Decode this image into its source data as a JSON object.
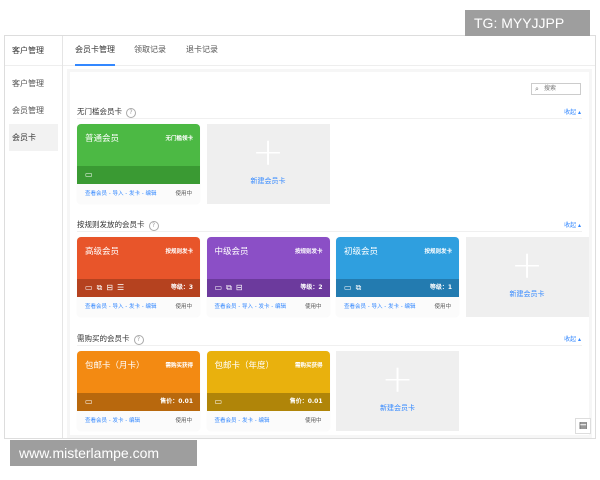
{
  "sidebar": {
    "header": "客户管理",
    "items": [
      {
        "label": "客户管理"
      },
      {
        "label": "会员管理"
      },
      {
        "label": "会员卡",
        "active": true
      }
    ]
  },
  "tabs": [
    {
      "label": "会员卡管理",
      "active": true
    },
    {
      "label": "领取记录"
    },
    {
      "label": "退卡记录"
    }
  ],
  "search": {
    "placeholder": "搜索",
    "icon": "search-icon"
  },
  "collapse_label": "收起 ▴",
  "new_card_label": "新建会员卡",
  "sections": [
    {
      "title": "无门槛会员卡",
      "cards": [
        {
          "name": "普通会员",
          "type": "无门槛领卡",
          "color": "#4cb944",
          "strip": "#3a9a33",
          "icons": 1,
          "right": "",
          "links": "查看会员 - 导入 - 发卡 - 编辑",
          "status": "使用中"
        }
      ]
    },
    {
      "title": "按规则发放的会员卡",
      "cards": [
        {
          "name": "高级会员",
          "type": "按规则发卡",
          "color": "#e8552a",
          "strip": "#b5421f",
          "icons": 4,
          "right": "等级：3",
          "links": "查看会员 - 导入 - 发卡 - 编辑",
          "status": "使用中"
        },
        {
          "name": "中级会员",
          "type": "按规则发卡",
          "color": "#8b4fc6",
          "strip": "#6c3a9d",
          "icons": 3,
          "right": "等级：2",
          "links": "查看会员 - 导入 - 发卡 - 编辑",
          "status": "使用中"
        },
        {
          "name": "初级会员",
          "type": "按规则发卡",
          "color": "#2f9fdf",
          "strip": "#237bb0",
          "icons": 2,
          "right": "等级：1",
          "links": "查看会员 - 导入 - 发卡 - 编辑",
          "status": "使用中"
        }
      ]
    },
    {
      "title": "需购买的会员卡",
      "cards": [
        {
          "name": "包邮卡（月卡）",
          "type": "需购买获得",
          "color": "#f38a12",
          "strip": "#b8680d",
          "icons": 1,
          "right": "售价：0.01",
          "links": "查看会员 - 发卡 - 编辑",
          "status": "使用中"
        },
        {
          "name": "包邮卡（年度）",
          "type": "需购买获得",
          "color": "#e9b10d",
          "strip": "#b08509",
          "icons": 1,
          "right": "售价：0.01",
          "links": "查看会员 - 发卡 - 编辑",
          "status": "使用中"
        }
      ]
    }
  ],
  "watermarks": {
    "top": "TG: MYYJJPP",
    "bottom": "www.misterlampe.com"
  }
}
